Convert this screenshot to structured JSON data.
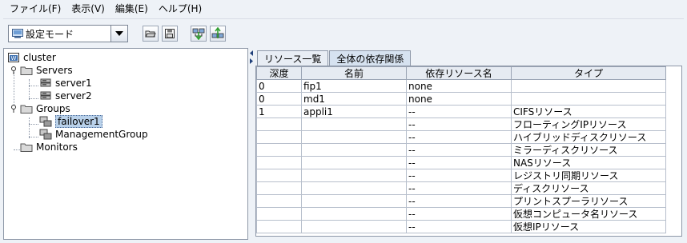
{
  "menubar": {
    "items": [
      "ファイル(F)",
      "表示(V)",
      "編集(E)",
      "ヘルプ(H)"
    ]
  },
  "toolbar": {
    "mode_select": {
      "value": "設定モード",
      "icon": "config-mode-icon"
    },
    "buttons": [
      {
        "name": "open-button",
        "icon": "folder-open-icon"
      },
      {
        "name": "save-button",
        "icon": "floppy-disk-icon"
      },
      {
        "name": "download-button",
        "icon": "network-download-icon"
      },
      {
        "name": "upload-button",
        "icon": "network-upload-icon"
      }
    ]
  },
  "tree": {
    "root": "cluster",
    "servers": {
      "label": "Servers",
      "items": [
        "server1",
        "server2"
      ]
    },
    "groups": {
      "label": "Groups",
      "items": [
        "failover1",
        "ManagementGroup"
      ],
      "selected": "failover1"
    },
    "monitors": {
      "label": "Monitors"
    }
  },
  "tabs": [
    {
      "label": "リソース一覧",
      "active": false
    },
    {
      "label": "全体の依存関係",
      "active": true
    }
  ],
  "table": {
    "headers": [
      "深度",
      "名前",
      "依存リソース名",
      "タイプ"
    ],
    "rows": [
      [
        "0",
        "fip1",
        "none",
        ""
      ],
      [
        "0",
        "md1",
        "none",
        ""
      ],
      [
        "1",
        "appli1",
        "--",
        "CIFSリソース"
      ],
      [
        "",
        "",
        "--",
        "フローティングIPリソース"
      ],
      [
        "",
        "",
        "--",
        "ハイブリッドディスクリソース"
      ],
      [
        "",
        "",
        "--",
        "ミラーディスクリソース"
      ],
      [
        "",
        "",
        "--",
        "NASリソース"
      ],
      [
        "",
        "",
        "--",
        "レジストリ同期リソース"
      ],
      [
        "",
        "",
        "--",
        "ディスクリソース"
      ],
      [
        "",
        "",
        "--",
        "プリントスプーラリソース"
      ],
      [
        "",
        "",
        "--",
        "仮想コンピュータ名リソース"
      ],
      [
        "",
        "",
        "--",
        "仮想IPリソース"
      ]
    ]
  },
  "colors": {
    "background": "#eef2f7",
    "selection": "#b9d1ea",
    "active_tab": "#d6e2f0",
    "border": "#8e98a8"
  }
}
